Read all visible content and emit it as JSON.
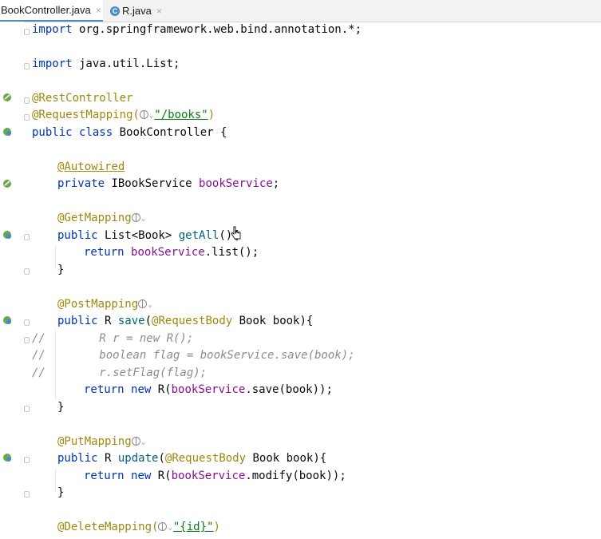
{
  "tabs": [
    {
      "label": "BookController.java",
      "close": "×",
      "active": true
    },
    {
      "label": "R.java",
      "close": "×",
      "icon": "C",
      "active": false
    }
  ],
  "code": {
    "l1": {
      "kw": "import",
      "rest": " org.springframework.web.bind.annotation.*;"
    },
    "l2": {
      "kw": "import",
      "rest": " java.util.List;"
    },
    "l3": {
      "ann": "@RestController"
    },
    "l4": {
      "ann": "@RequestMapping(",
      "str": "\"/books\"",
      "close": ")"
    },
    "l5": {
      "kw1": "public",
      "kw2": "class",
      "rest": " BookController {"
    },
    "l6": {
      "ann": "@Autowired"
    },
    "l7": {
      "kw": "private",
      "type": " IBookService ",
      "fld": "bookService",
      "end": ";"
    },
    "l8": {
      "ann": "@GetMapping"
    },
    "l9": {
      "kw": "public",
      "type": " List<Book> ",
      "mth": "getAll",
      "end": "(){"
    },
    "l10": {
      "kw": "return",
      "fld": "bookService",
      "end": ".list();"
    },
    "l11": {
      "text": "}"
    },
    "l12": {
      "ann": "@PostMapping"
    },
    "l13": {
      "kw": "public",
      "type": " R ",
      "mth": "save",
      "p1": "(",
      "ann2": "@RequestBody",
      "end": " Book book){"
    },
    "l14": {
      "cmt": "//        R r = new R();"
    },
    "l15": {
      "cmt": "//        boolean flag = bookService.save(book);"
    },
    "l16": {
      "cmt": "//        r.setFlag(flag);"
    },
    "l17": {
      "kw": "return",
      "kw2": "new",
      "mid": " R(",
      "fld": "bookService",
      "end": ".save(book));"
    },
    "l18": {
      "text": "}"
    },
    "l19": {
      "ann": "@PutMapping"
    },
    "l20": {
      "kw": "public",
      "type": " R ",
      "mth": "update",
      "p1": "(",
      "ann2": "@RequestBody",
      "end": " Book book){"
    },
    "l21": {
      "kw": "return",
      "kw2": "new",
      "mid": " R(",
      "fld": "bookService",
      "end": ".modify(book));"
    },
    "l22": {
      "text": "}"
    },
    "l23": {
      "ann": "@DeleteMapping(",
      "str": "\"{id}\"",
      "close": ")"
    }
  },
  "colors": {
    "keyword": "#0033b3",
    "annotation": "#9e880d",
    "string": "#067d17",
    "field": "#871094",
    "method": "#00627a",
    "comment": "#8c8c8c"
  },
  "icons": {
    "gutter": "spring-bean-icon",
    "web": "web-endpoint-icon",
    "tab": "class-icon"
  }
}
